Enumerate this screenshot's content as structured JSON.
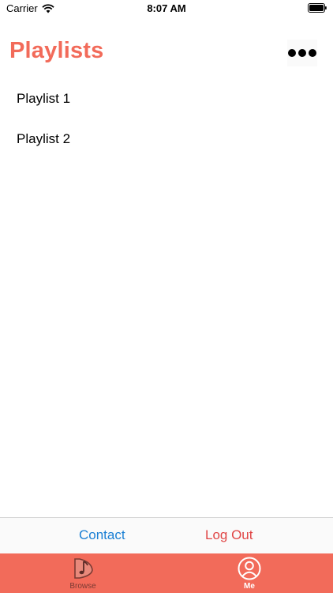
{
  "status_bar": {
    "carrier": "Carrier",
    "time": "8:07 AM"
  },
  "header": {
    "title": "Playlists",
    "more_icon": "more-dots-icon"
  },
  "playlists": [
    {
      "label": "Playlist 1"
    },
    {
      "label": "Playlist 2"
    }
  ],
  "actions": {
    "contact_label": "Contact",
    "logout_label": "Log Out"
  },
  "tab_bar": {
    "tabs": [
      {
        "label": "Browse",
        "icon": "music-note-icon",
        "selected": false
      },
      {
        "label": "Me",
        "icon": "user-icon",
        "selected": true
      }
    ]
  },
  "colors": {
    "accent": "#F26B5A",
    "contact": "#1a7fd4",
    "logout": "#e04444"
  }
}
